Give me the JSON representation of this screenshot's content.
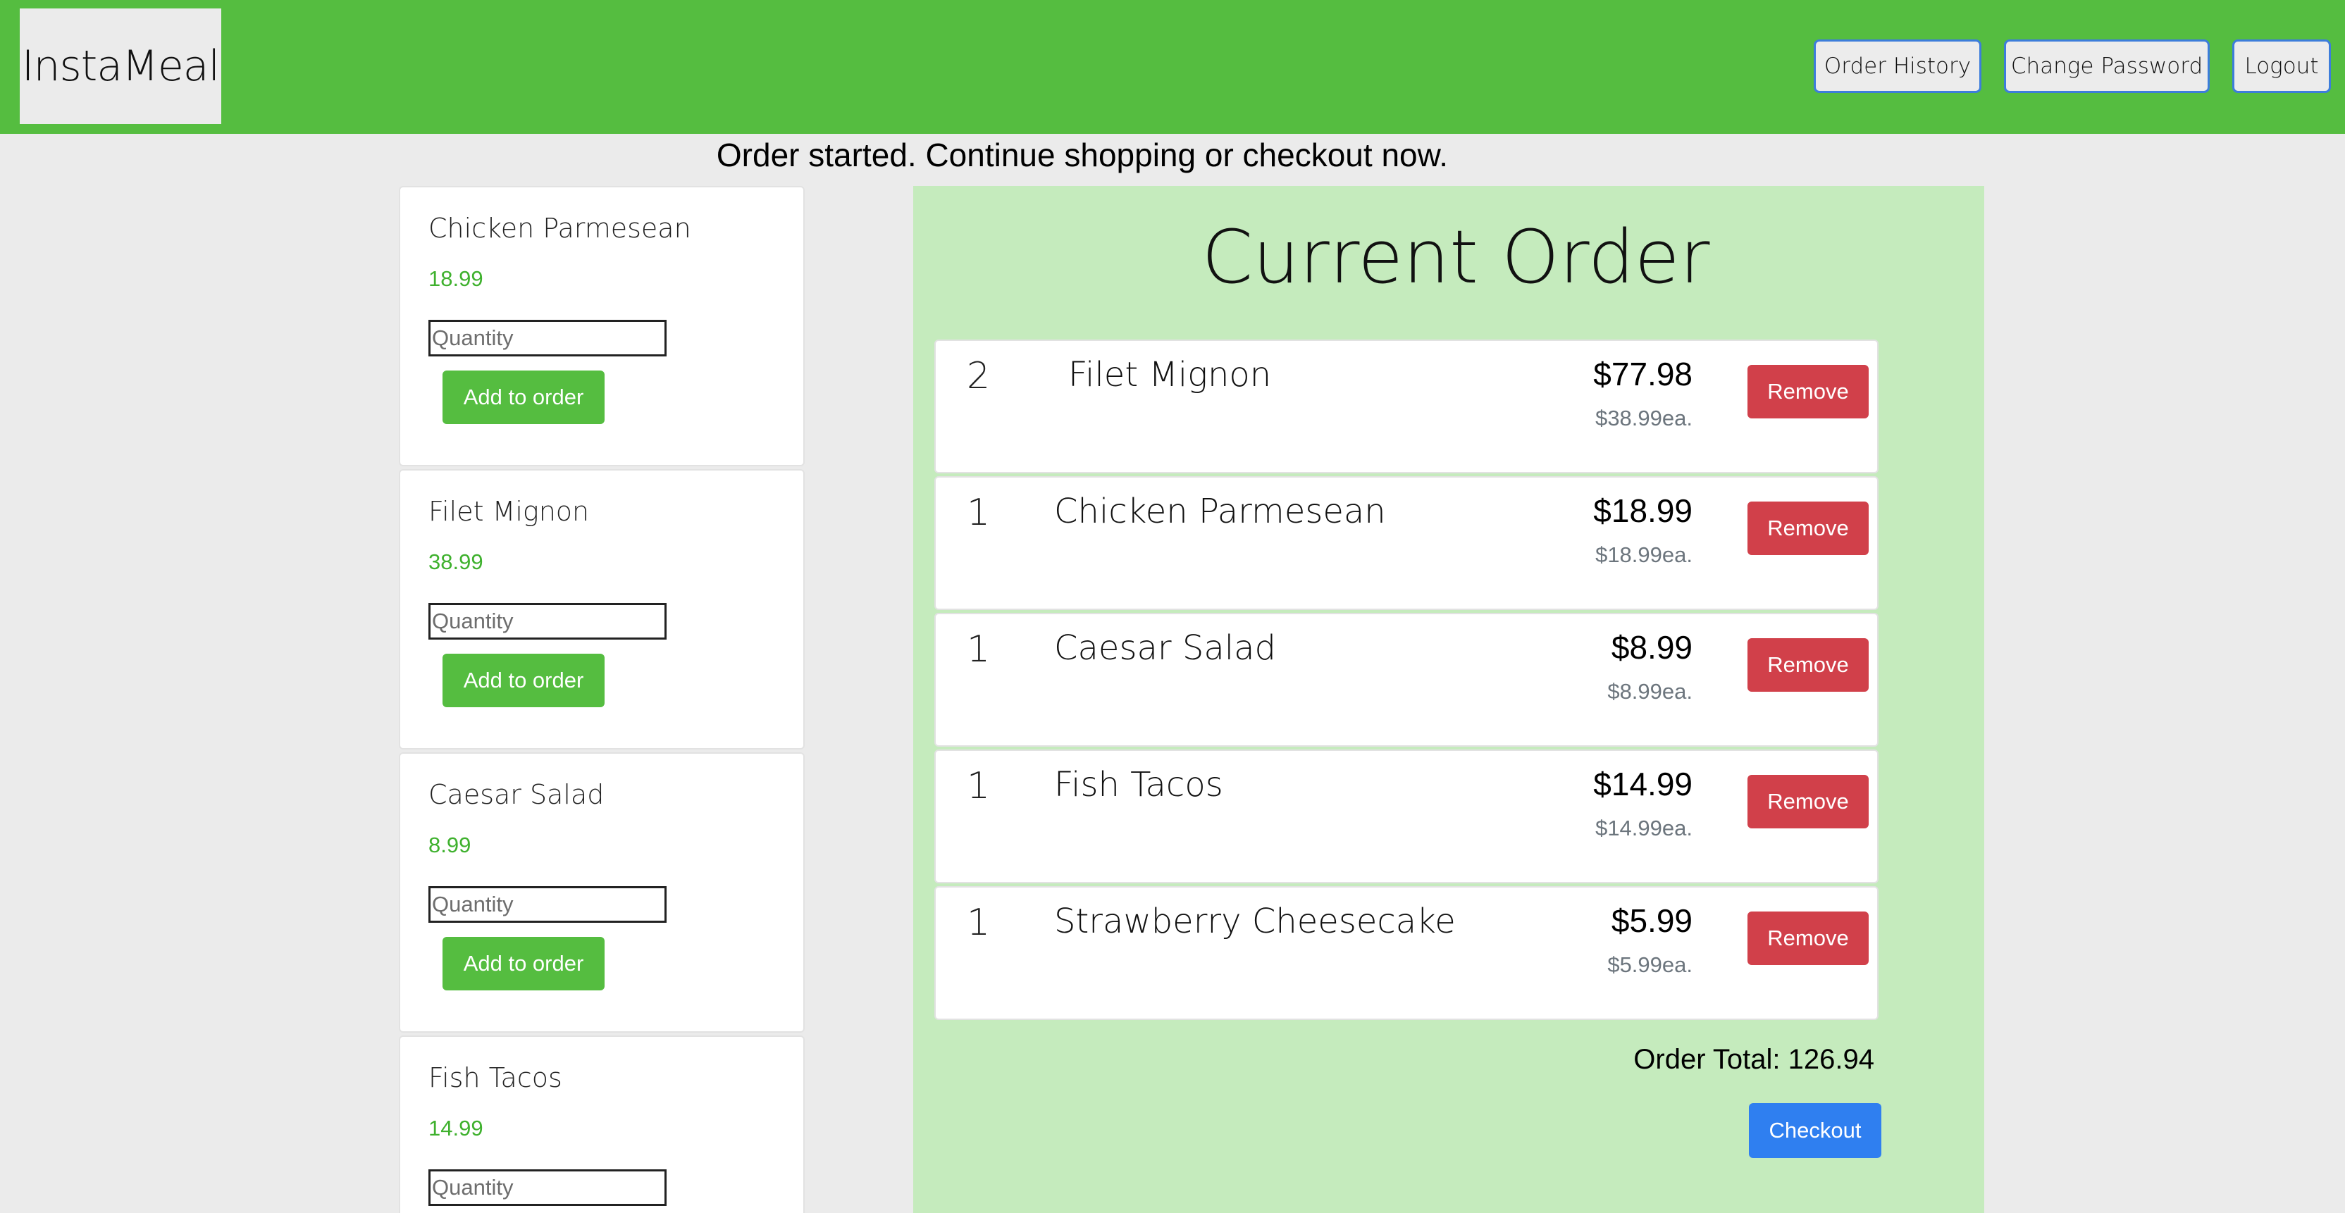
{
  "header": {
    "logo_text": "InstaMeal",
    "nav": [
      {
        "label": "Order History"
      },
      {
        "label": "Change Password"
      },
      {
        "label": "Logout"
      }
    ]
  },
  "banner": {
    "message": "Order started. Continue shopping or checkout now."
  },
  "menu": {
    "items": [
      {
        "name": "Chicken Parmesean",
        "price": "18.99",
        "quantity_placeholder": "Quantity",
        "add_label": "Add to order"
      },
      {
        "name": "Filet Mignon",
        "price": "38.99",
        "quantity_placeholder": "Quantity",
        "add_label": "Add to order"
      },
      {
        "name": "Caesar Salad",
        "price": "8.99",
        "quantity_placeholder": "Quantity",
        "add_label": "Add to order"
      },
      {
        "name": "Fish Tacos",
        "price": "14.99",
        "quantity_placeholder": "Quantity",
        "add_label": "Add to order"
      }
    ]
  },
  "order": {
    "title": "Current Order",
    "items": [
      {
        "qty": "2",
        "name": "Filet Mignon",
        "total": "$77.98",
        "each": "$38.99ea.",
        "remove_label": "Remove"
      },
      {
        "qty": "1",
        "name": "Chicken Parmesean",
        "total": "$18.99",
        "each": "$18.99ea.",
        "remove_label": "Remove"
      },
      {
        "qty": "1",
        "name": "Caesar Salad",
        "total": "$8.99",
        "each": "$8.99ea.",
        "remove_label": "Remove"
      },
      {
        "qty": "1",
        "name": "Fish Tacos",
        "total": "$14.99",
        "each": "$14.99ea.",
        "remove_label": "Remove"
      },
      {
        "qty": "1",
        "name": "Strawberry Cheesecake",
        "total": "$5.99",
        "each": "$5.99ea.",
        "remove_label": "Remove"
      }
    ],
    "total_text": "Order Total: 126.94",
    "checkout_label": "Checkout"
  },
  "colors": {
    "brand_green": "#55bd40",
    "panel_green": "#c5ebbd",
    "price_green": "#3fb12e",
    "remove_red": "#d1404a",
    "checkout_blue": "#2f7ff0",
    "nav_border_blue": "#3d7ddb"
  }
}
